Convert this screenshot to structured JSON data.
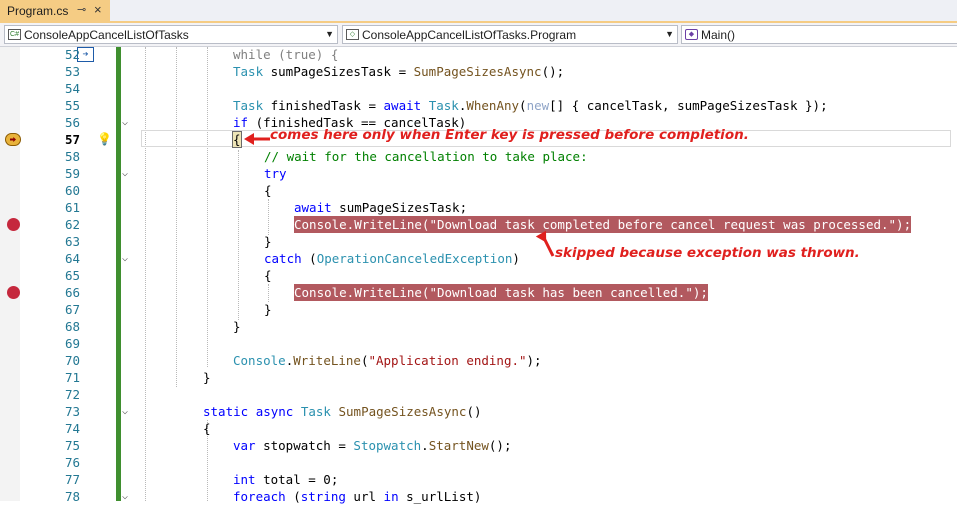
{
  "tab": {
    "title": "Program.cs",
    "pin": "⊸",
    "close": "×"
  },
  "navbar": {
    "project": "ConsoleAppCancelListOfTasks",
    "type": "ConsoleAppCancelListOfTasks.Program",
    "member": "Main()"
  },
  "lines": [
    {
      "n": "52",
      "text": "while (true) {"
    },
    {
      "n": "53",
      "text": "Task sumPageSizesTask = SumPageSizesAsync();"
    },
    {
      "n": "54",
      "text": ""
    },
    {
      "n": "55",
      "text": ""
    },
    {
      "n": "56",
      "text": "Task finishedTask = await Task.WhenAny(new[] { cancelTask, sumPageSizesTask });"
    },
    {
      "n": "57",
      "text": "if (finishedTask == cancelTask)"
    },
    {
      "n": "58",
      "text": "{"
    },
    {
      "n": "59",
      "text": "// wait for the cancellation to take place:"
    },
    {
      "n": "60",
      "text": "try"
    },
    {
      "n": "61",
      "text": "{"
    },
    {
      "n": "62",
      "text": "await sumPageSizesTask;"
    },
    {
      "n": "63",
      "text": "Console.WriteLine(\"Download task completed before cancel request was processed.\");"
    },
    {
      "n": "64",
      "text": "}"
    },
    {
      "n": "65",
      "text": "catch (OperationCanceledException)"
    },
    {
      "n": "66",
      "text": "{"
    },
    {
      "n": "67",
      "text": "Console.WriteLine(\"Download task has been cancelled.\");"
    },
    {
      "n": "68",
      "text": "}"
    },
    {
      "n": "69",
      "text": "}"
    },
    {
      "n": "70",
      "text": ""
    },
    {
      "n": "71",
      "text": "Console.WriteLine(\"Application ending.\");"
    },
    {
      "n": "72",
      "text": "}"
    },
    {
      "n": "73",
      "text": ""
    },
    {
      "n": "74",
      "text": "static async Task SumPageSizesAsync()"
    },
    {
      "n": "75",
      "text": "{"
    },
    {
      "n": "76",
      "text": "var stopwatch = Stopwatch.StartNew();"
    },
    {
      "n": "77",
      "text": ""
    },
    {
      "n": "78",
      "text": "int total = 0;"
    }
  ],
  "line_numbers": [
    "52",
    "53",
    "54",
    "55",
    "56",
    "57",
    "58",
    "59",
    "60",
    "61",
    "62",
    "63",
    "64",
    "65",
    "66",
    "67",
    "68",
    "69",
    "70",
    "71",
    "72",
    "73",
    "74",
    "75",
    "76",
    "77",
    "78"
  ],
  "annotations": {
    "enter_key": "comes here only when Enter key is pressed before completion.",
    "skipped": "skipped because exception was thrown."
  },
  "code": {
    "l52": "while (true) {",
    "l53_a": "Task",
    "l53_b": " sumPageSizesTask = ",
    "l53_c": "SumPageSizesAsync",
    "l53_d": "();",
    "l56_a": "Task",
    "l56_b": " finishedTask = ",
    "l56_c": "await",
    "l56_d": " ",
    "l56_e": "Task",
    "l56_f": ".",
    "l56_g": "WhenAny",
    "l56_h": "(",
    "l56_i": "new",
    "l56_j": "[] { cancelTask, sumPageSizesTask });",
    "l57_a": "if",
    "l57_b": " (finishedTask == cancelTask)",
    "l58": "{",
    "l59": "// wait for the cancellation to take place:",
    "l60": "try",
    "l61": "{",
    "l62_a": "await",
    "l62_b": " sumPageSizesTask;",
    "l63": "Console.WriteLine(\"Download task completed before cancel request was processed.\");",
    "l64": "}",
    "l65_a": "catch",
    "l65_b": " (",
    "l65_c": "OperationCanceledException",
    "l65_d": ")",
    "l66": "{",
    "l67": "Console.WriteLine(\"Download task has been cancelled.\");",
    "l68": "}",
    "l69": "}",
    "l71_a": "Console",
    "l71_b": ".",
    "l71_c": "WriteLine",
    "l71_d": "(",
    "l71_e": "\"Application ending.\"",
    "l71_f": ");",
    "l72": "}",
    "l74_a": "static",
    "l74_b": " ",
    "l74_c": "async",
    "l74_d": " ",
    "l74_e": "Task",
    "l74_f": " ",
    "l74_g": "SumPageSizesAsync",
    "l74_h": "()",
    "l75": "{",
    "l76_a": "var",
    "l76_b": " stopwatch = ",
    "l76_c": "Stopwatch",
    "l76_d": ".",
    "l76_e": "StartNew",
    "l76_f": "();",
    "l77_a": "int",
    "l77_b": " total = 0;",
    "l78_a": "foreach",
    "l78_b": " (",
    "l78_c": "string",
    "l78_d": " url ",
    "l78_e": "in",
    "l78_f": " s_urlList)"
  },
  "colors": {
    "breakpoint": "#c5283d",
    "highlight": "#b2595f",
    "annotation": "#e0201e",
    "change_bar": "#3f8f2f"
  }
}
